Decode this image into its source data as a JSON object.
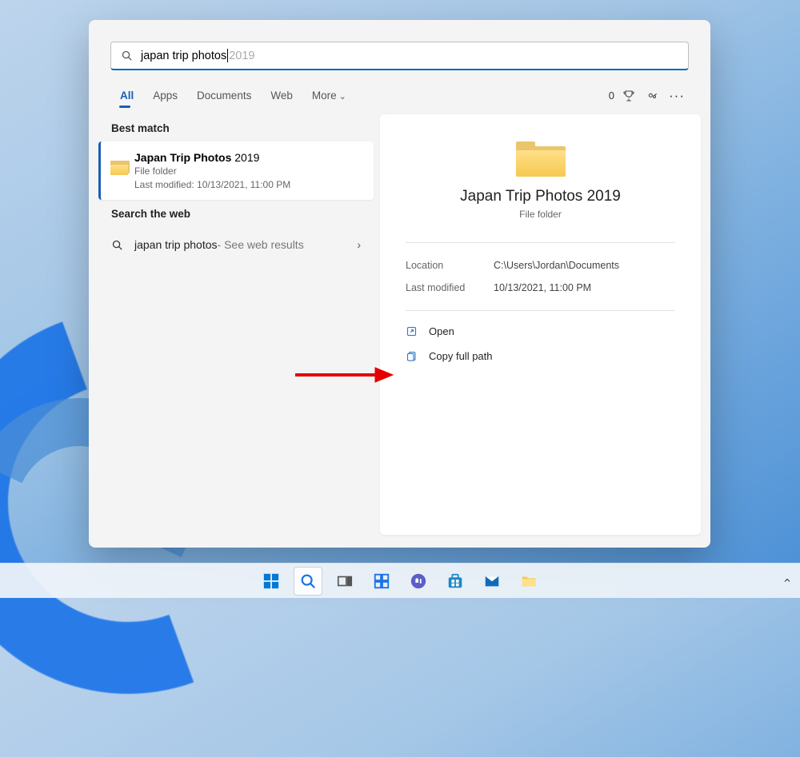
{
  "search": {
    "typed": "japan trip photos",
    "suggestion": " 2019"
  },
  "tabs": [
    "All",
    "Apps",
    "Documents",
    "Web",
    "More"
  ],
  "active_tab": "All",
  "rewards_points": "0",
  "left": {
    "best_match_label": "Best match",
    "best_result": {
      "title_match": "Japan Trip Photos",
      "title_rest": " 2019",
      "type": "File folder",
      "meta": "Last modified: 10/13/2021, 11:00 PM"
    },
    "search_web_label": "Search the web",
    "web_query": "japan trip photos",
    "web_suffix": " - See web results"
  },
  "detail": {
    "title": "Japan Trip Photos 2019",
    "type": "File folder",
    "location_label": "Location",
    "location_value": "C:\\Users\\Jordan\\Documents",
    "modified_label": "Last modified",
    "modified_value": "10/13/2021, 11:00 PM",
    "open_label": "Open",
    "copy_label": "Copy full path"
  }
}
